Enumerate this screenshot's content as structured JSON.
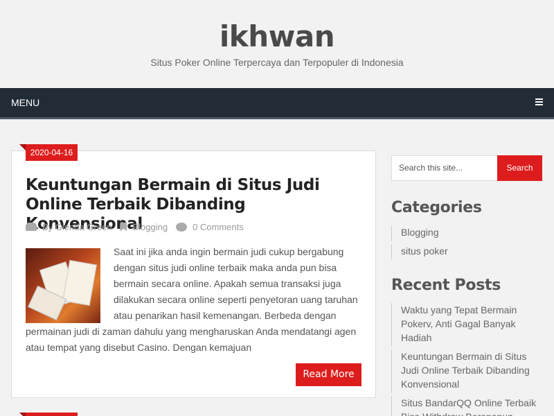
{
  "header": {
    "title": "ikhwan",
    "description": "Situs Poker Online Terpercaya dan Terpopuler di Indonesia"
  },
  "nav": {
    "menu_label": "MENU",
    "menu_icon": "bars-icon"
  },
  "post": {
    "date": "2020-04-16",
    "title": "Keuntungan Bermain di Situs Judi Online Terbaik Dibanding Konvensional",
    "author": "By Glenda Green",
    "category": "Blogging",
    "comments": "0 Comments",
    "excerpt": "Saat ini jika anda ingin bermain judi cukup bergabung dengan situs judi online terbaik maka anda pun bisa bermain secara online. Apakah semua transaksi juga dilakukan secara online seperti penyetoran uang taruhan atau penarikan hasil kemenangan. Berbeda dengan permainan judi di zaman dahulu yang mengharuskan Anda mendatangi agen atau tempat yang disebut Casino. Dengan kemajuan",
    "read_more": "Read More"
  },
  "sidebar": {
    "search": {
      "placeholder": "Search this site...",
      "button": "Search"
    },
    "categories": {
      "title": "Categories",
      "items": [
        "Blogging",
        "situs poker"
      ]
    },
    "recent": {
      "title": "Recent Posts",
      "items": [
        "Waktu yang Tepat Bermain Pokerv, Anti Gagal Banyak Hadiah",
        "Keuntungan Bermain di Situs Judi Online Terbaik Dibanding Konvensional",
        "Situs BandarQQ Online Terbaik Bisa Withdraw Berapapun"
      ]
    }
  },
  "colors": {
    "accent": "#dd1d1d",
    "nav_bg": "#212c37",
    "page_bg": "#f2f2f2"
  }
}
